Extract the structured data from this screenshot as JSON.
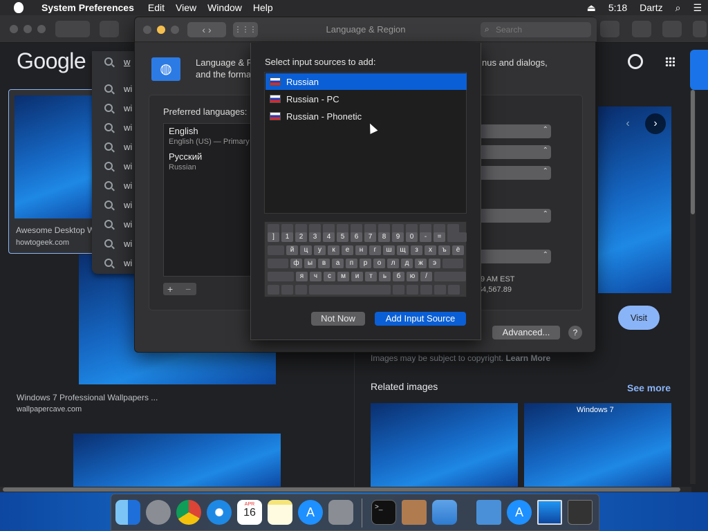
{
  "menubar": {
    "app_name": "System Preferences",
    "menus": [
      "Edit",
      "View",
      "Window",
      "Help"
    ],
    "time": "5:18",
    "user": "Dartz"
  },
  "browser": {
    "logo": "Google",
    "search_partial": "w",
    "suggestion_prefix": "wi",
    "results": [
      {
        "title": "Awesome Desktop W",
        "source": "howtogeek.com"
      },
      {
        "title": "Windows 7 Professional Wallpapers ...",
        "source": "wallpapercave.com"
      }
    ],
    "panel": {
      "visit_label": "Visit",
      "copyright": "Images may be subject to copyright.",
      "learn_more": "Learn More",
      "related_label": "Related images",
      "see_more": "See more",
      "related_thumb_caption": "Windows 7"
    }
  },
  "prefs": {
    "window_title": "Language & Region",
    "search_placeholder": "Search",
    "header_text_1": "Language & R",
    "header_text_2": "and the forma",
    "header_right": "nus and dialogs,",
    "preferred_languages_label": "Preferred languages:",
    "languages": [
      {
        "name": "English",
        "detail": "English (US) — Primary"
      },
      {
        "name": "Русский",
        "detail": "Russian"
      }
    ],
    "time_sample": "9 AM EST",
    "number_sample": "$4,567.89",
    "advanced_label": "Advanced...",
    "help_label": "?"
  },
  "sheet": {
    "title": "Select input sources to add:",
    "sources": [
      {
        "label": "Russian",
        "selected": true
      },
      {
        "label": "Russian - PC",
        "selected": false
      },
      {
        "label": "Russian - Phonetic",
        "selected": false
      }
    ],
    "keyboard_rows": [
      [
        "]",
        "1",
        "2",
        "3",
        "4",
        "5",
        "6",
        "7",
        "8",
        "9",
        "0",
        "-",
        "="
      ],
      [
        "й",
        "ц",
        "у",
        "к",
        "е",
        "н",
        "г",
        "ш",
        "щ",
        "з",
        "х",
        "ъ",
        "ё"
      ],
      [
        "ф",
        "ы",
        "в",
        "а",
        "п",
        "р",
        "о",
        "л",
        "д",
        "ж",
        "э"
      ],
      [
        "я",
        "ч",
        "с",
        "м",
        "и",
        "т",
        "ь",
        "б",
        "ю",
        "/"
      ]
    ],
    "not_now_label": "Not Now",
    "add_label": "Add Input Source"
  },
  "dock": {
    "calendar_month": "APR",
    "calendar_day": "16"
  },
  "colors": {
    "accent": "#0a5fd6",
    "visit_button": "#8ab4f8"
  }
}
